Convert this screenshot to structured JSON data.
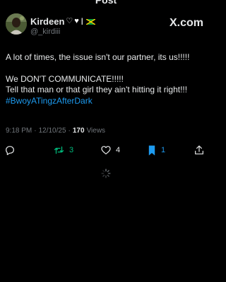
{
  "header": {
    "title": "Post",
    "display_name": "Kirdeen",
    "handle": "@_kirdiii",
    "brand": "X.com"
  },
  "post": {
    "line1": "A lot of times, the issue isn't our partner, its us!!!!!",
    "line2": "We DON'T COMMUNICATE!!!!!",
    "line3": "Tell that man or that girl they ain't hitting it right!!!",
    "hashtag": "#BwoyATingzAfterDark"
  },
  "meta": {
    "time": "9:18 PM",
    "separator": "·",
    "date": "12/10/25",
    "views_count": "170",
    "views_label": "Views"
  },
  "actions": {
    "reposts": "3",
    "likes": "4",
    "bookmarks": "1"
  },
  "colors": {
    "background": "#000000",
    "text": "#e7e9ea",
    "muted": "#71767b",
    "link": "#1d9bf0",
    "repost": "#00ba7c"
  },
  "icons": [
    "reply-icon",
    "repost-icon",
    "like-icon",
    "bookmark-icon",
    "share-icon",
    "loading-spinner-icon",
    "x-logo-icon",
    "jamaica-flag-icon"
  ]
}
